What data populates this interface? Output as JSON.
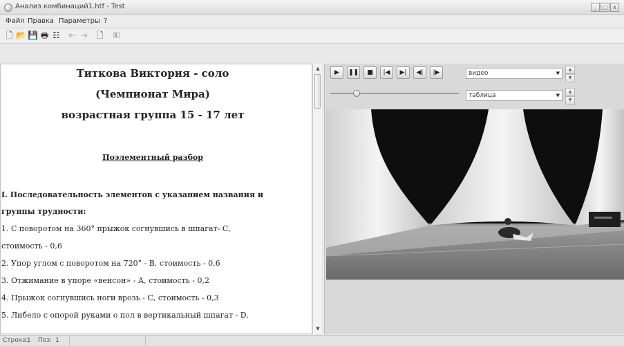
{
  "window": {
    "title": "Анализ комбинаций1.htf - Test",
    "buttons": {
      "minimize": "_",
      "maximize": "□",
      "close": "x"
    }
  },
  "menu": [
    "Файл",
    "Правка",
    "Параметры",
    "?"
  ],
  "toolbar": {
    "icons": [
      "new-file-icon",
      "open-folder-icon",
      "save-icon",
      "print-icon",
      "properties-icon",
      "undo-icon",
      "redo-icon",
      "page-icon",
      "edit-page-icon"
    ],
    "glyphs": [
      "🗋",
      "📂",
      "💾",
      "🖶",
      "☷",
      "⇤",
      "⇥",
      "🗋",
      "🗉"
    ]
  },
  "document": {
    "title": "Титкова Виктория  -  соло",
    "championship": "(Чемпионат Мира)",
    "age_group": "возрастная группа 15  -  17 лет",
    "section_title": "Поэлементный разбор",
    "heading_line1": "I. Последовательность элементов с указанием названия и",
    "heading_line2": "группы трудности:",
    "lines": [
      "1. С поворотом на 360° прыжок согнувшись в шпагат- С,",
      "стоимость - 0,6",
      "2. Упор углом с поворотом на 720°  -  В, стоимость  -  0,6",
      "3. Отжимание в упоре «венсон»  - А, стоимость  -  0,2",
      "4. Прыжок согнувшись ноги врозь  - С, стоимость  -  0,3",
      "5. Либело с опорой руками о пол в вертикальный шпагат  - D,"
    ]
  },
  "player": {
    "buttons": [
      {
        "name": "play-button",
        "glyph": "▶"
      },
      {
        "name": "pause-button",
        "glyph": "❚❚"
      },
      {
        "name": "stop-button",
        "glyph": "■"
      },
      {
        "name": "go-start-button",
        "glyph": "|◀"
      },
      {
        "name": "go-end-button",
        "glyph": "▶|"
      },
      {
        "name": "step-back-button",
        "glyph": "◀|"
      },
      {
        "name": "step-forward-button",
        "glyph": "|▶"
      }
    ],
    "video_select": "видео",
    "table_select": "таблица",
    "position_fraction": 0.19
  },
  "status": {
    "row_label": "Строка:",
    "row_value": "1",
    "pos_label": "Поз:",
    "pos_value": "1"
  },
  "colors": {
    "accent": "#4a4a4a"
  }
}
